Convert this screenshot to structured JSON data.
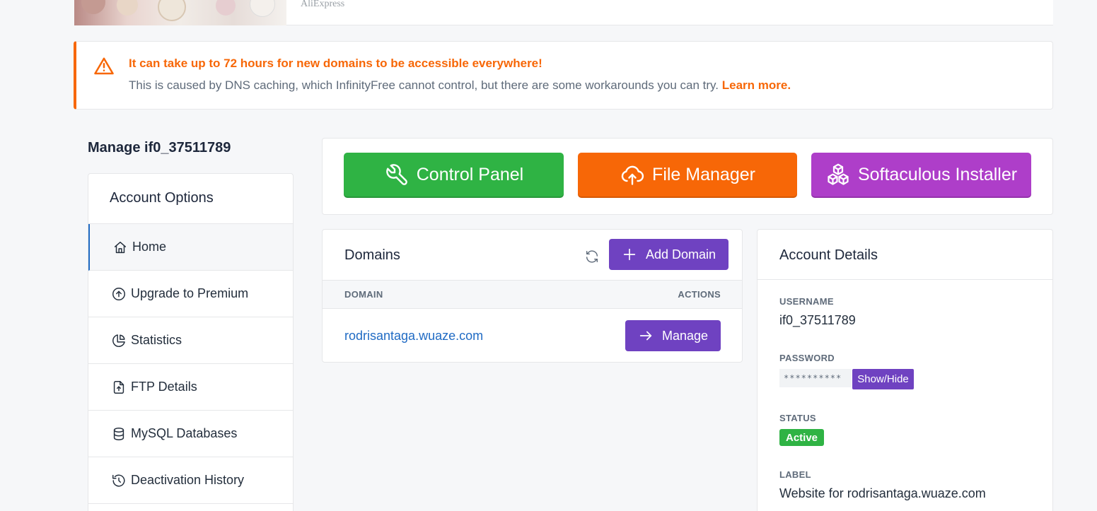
{
  "ad": {
    "source": "AliExpress"
  },
  "alert": {
    "title": "It can take up to 72 hours for new domains to be accessible everywhere!",
    "text": "This is caused by DNS caching, which InfinityFree cannot control, but there are some workarounds you can try.",
    "link": "Learn more.",
    "color": "#f76707"
  },
  "page": {
    "manage_title": "Manage if0_37511789"
  },
  "sidebar": {
    "header": "Account Options",
    "items": [
      {
        "label": "Home",
        "icon": "home-icon",
        "active": true
      },
      {
        "label": "Upgrade to Premium",
        "icon": "arrow-up-circle-icon"
      },
      {
        "label": "Statistics",
        "icon": "chart-pie-icon"
      },
      {
        "label": "FTP Details",
        "icon": "file-upload-icon"
      },
      {
        "label": "MySQL Databases",
        "icon": "database-icon"
      },
      {
        "label": "Deactivation History",
        "icon": "history-icon"
      }
    ]
  },
  "tools": {
    "control_panel": "Control Panel",
    "file_manager": "File Manager",
    "softaculous": "Softaculous Installer",
    "colors": {
      "control_panel": "#2fb344",
      "file_manager": "#f76707",
      "softaculous": "#ae3ec9"
    }
  },
  "domains": {
    "title": "Domains",
    "add_label": "Add Domain",
    "columns": [
      "DOMAIN",
      "ACTIONS"
    ],
    "rows": [
      {
        "domain": "rodrisantaga.wuaze.com",
        "action": "Manage"
      }
    ]
  },
  "account_details": {
    "title": "Account Details",
    "username_label": "USERNAME",
    "username": "if0_37511789",
    "password_label": "PASSWORD",
    "password_mask": "**********",
    "show_hide": "Show/Hide",
    "status_label": "STATUS",
    "status": "Active",
    "label_label": "LABEL",
    "label": "Website for rodrisantaga.wuaze.com"
  }
}
